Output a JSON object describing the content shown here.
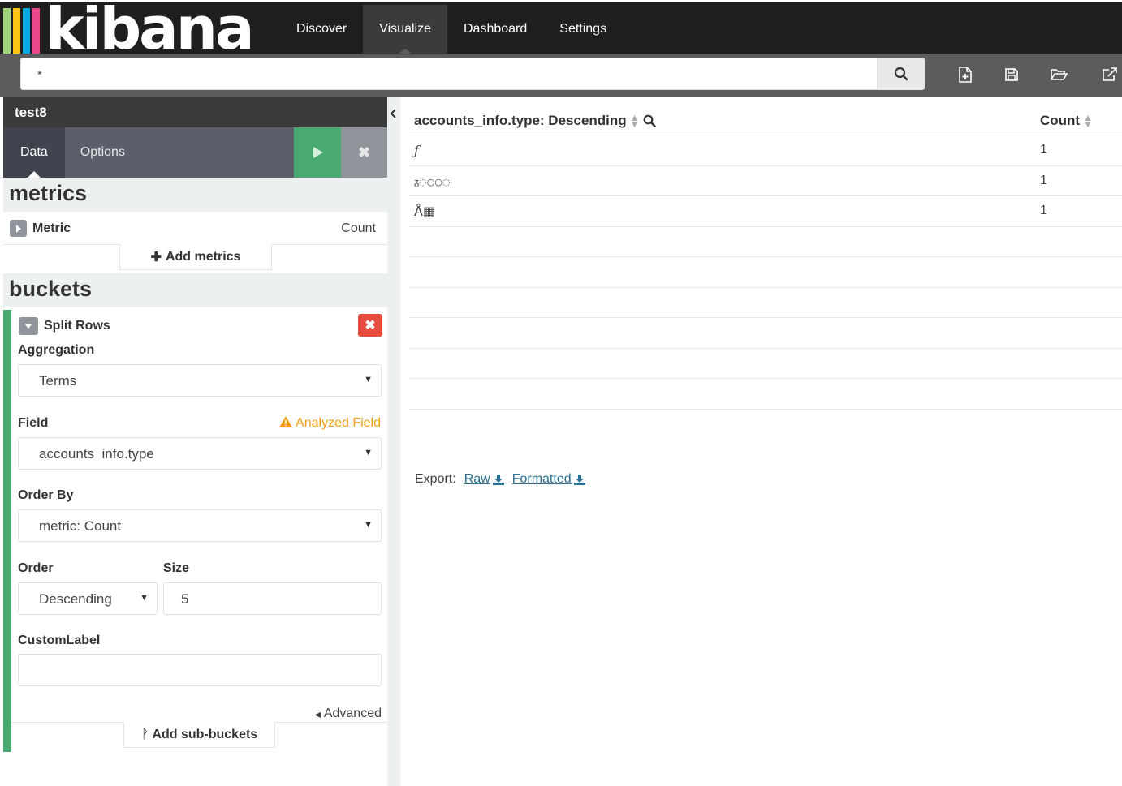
{
  "app": {
    "logo_text": "kibana",
    "logo_colors": [
      "#e8488b",
      "#00a9e5",
      "#fec514",
      "#3ebeb0",
      "#9fd37c"
    ]
  },
  "nav": {
    "items": [
      {
        "label": "Discover",
        "active": false
      },
      {
        "label": "Visualize",
        "active": true
      },
      {
        "label": "Dashboard",
        "active": false
      },
      {
        "label": "Settings",
        "active": false
      }
    ]
  },
  "search": {
    "query": "*"
  },
  "toolbar": {
    "icons": [
      "new-visualization-icon",
      "save-icon",
      "open-folder-icon",
      "share-icon"
    ]
  },
  "editor": {
    "vis_title": "test8",
    "tabs": {
      "data": "Data",
      "options": "Options"
    },
    "metrics_heading": "metrics",
    "metric": {
      "label": "Metric",
      "value": "Count"
    },
    "add_metrics": "Add metrics",
    "buckets_heading": "buckets",
    "bucket": {
      "title": "Split Rows",
      "aggregation_label": "Aggregation",
      "aggregation_value": "Terms",
      "field_label": "Field",
      "field_warning": "Analyzed Field",
      "field_value": "accounts  info.type",
      "order_by_label": "Order By",
      "order_by_value": "metric: Count",
      "order_label": "Order",
      "order_value": "Descending",
      "size_label": "Size",
      "size_value": "5",
      "custom_label": "CustomLabel",
      "custom_value": "",
      "advanced": "Advanced"
    },
    "add_sub_buckets": "Add sub-buckets"
  },
  "table": {
    "columns": [
      "accounts_info.type: Descending",
      "Count"
    ],
    "rows": [
      {
        "term": "ƒ",
        "count": "1"
      },
      {
        "term": "ᵹ◌○○◌",
        "count": "1"
      },
      {
        "term": "Å▦",
        "count": "1"
      }
    ],
    "empty_rows": 6
  },
  "export": {
    "label": "Export:",
    "raw": "Raw",
    "formatted": "Formatted"
  }
}
